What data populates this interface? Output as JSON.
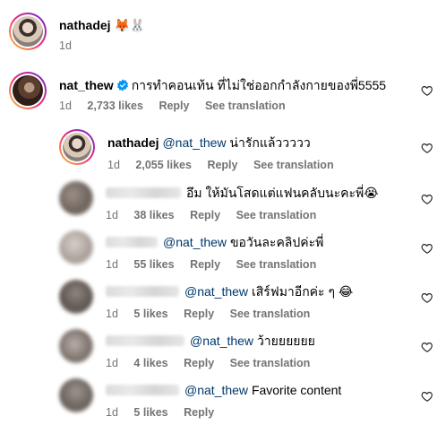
{
  "post": {
    "username": "nathadej",
    "caption": "🦊🐰",
    "time": "1d"
  },
  "comments": [
    {
      "username": "nat_thew",
      "verified": true,
      "text": "การทำคอนเท้น ที่ไม่ใช่ออกกำลังกายของพี่5555",
      "time": "1d",
      "likes": "2,733 likes",
      "reply": "Reply",
      "translate": "See translation"
    }
  ],
  "replies": [
    {
      "username": "nathadej",
      "mention": "@nat_thew",
      "text": "น่ารักแล้ววววว",
      "time": "1d",
      "likes": "2,055 likes",
      "reply": "Reply",
      "translate": "See translation"
    },
    {
      "mention": "",
      "text": "อึม ให้มันโสดแต่แฟนคลับนะคะพี่😭",
      "time": "1d",
      "likes": "38 likes",
      "reply": "Reply",
      "translate": "See translation"
    },
    {
      "mention": "@nat_thew",
      "text": "ขอวันละคลิปค่ะพี่",
      "time": "1d",
      "likes": "55 likes",
      "reply": "Reply",
      "translate": "See translation"
    },
    {
      "mention": "@nat_thew",
      "text": "เสิร์ฟมาอีกค่ะ ๆ 😂",
      "time": "1d",
      "likes": "5 likes",
      "reply": "Reply",
      "translate": "See translation"
    },
    {
      "mention": "@nat_thew",
      "text": "ว้ายยยยยย",
      "time": "1d",
      "likes": "4 likes",
      "reply": "Reply",
      "translate": "See translation"
    },
    {
      "mention": "@nat_thew",
      "text": "Favorite content",
      "time": "1d",
      "likes": "5 likes",
      "reply": "Reply",
      "translate": ""
    }
  ],
  "icons": {
    "like": "heart-outline-icon",
    "verified": "verified-badge-icon"
  },
  "colors": {
    "mention": "#00376b",
    "meta": "#737373",
    "verified": "#0095f6"
  }
}
